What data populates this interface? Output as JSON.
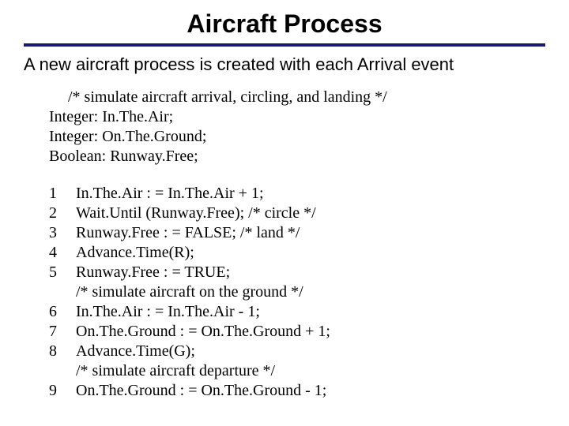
{
  "title": "Aircraft Process",
  "subtitle": "A new aircraft process is created with each Arrival event",
  "declarations": {
    "comment": "/* simulate aircraft arrival, circling, and landing */",
    "line1": "Integer: In.The.Air;",
    "line2": "Integer: On.The.Ground;",
    "line3": "Boolean: Runway.Free;"
  },
  "code": [
    {
      "n": "1",
      "text": "In.The.Air : = In.The.Air + 1;"
    },
    {
      "n": "2",
      "text": "Wait.Until (Runway.Free); /* circle */"
    },
    {
      "n": "3",
      "text": "Runway.Free : = FALSE;   /* land */"
    },
    {
      "n": "4",
      "text": "Advance.Time(R);"
    },
    {
      "n": "5",
      "text": "Runway.Free : = TRUE;"
    },
    {
      "n": "",
      "text": "/* simulate aircraft on the ground */"
    },
    {
      "n": "6",
      "text": "In.The.Air : = In.The.Air - 1;"
    },
    {
      "n": "7",
      "text": "On.The.Ground : = On.The.Ground + 1;"
    },
    {
      "n": "8",
      "text": "Advance.Time(G);"
    },
    {
      "n": "",
      "text": "/* simulate aircraft departure */"
    },
    {
      "n": "9",
      "text": "On.The.Ground : = On.The.Ground - 1;"
    }
  ]
}
